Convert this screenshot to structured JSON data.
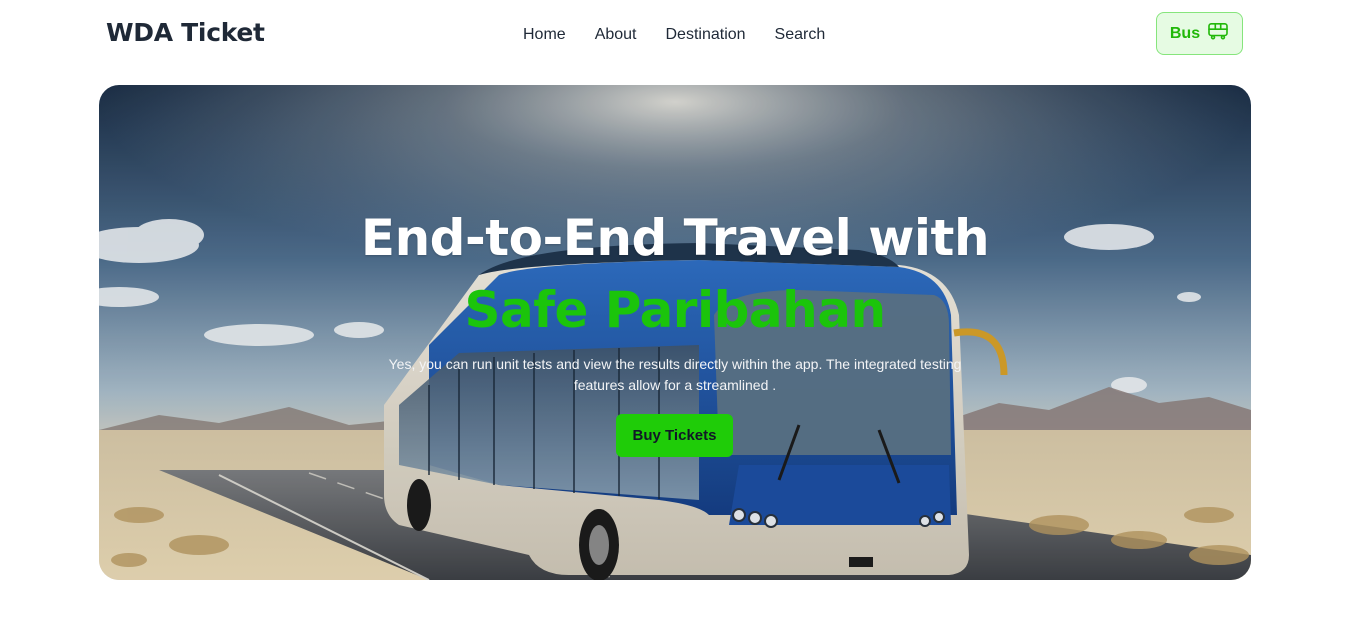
{
  "header": {
    "logo": "WDA Ticket",
    "nav": [
      {
        "label": "Home"
      },
      {
        "label": "About"
      },
      {
        "label": "Destination"
      },
      {
        "label": "Search"
      }
    ],
    "bus_button": {
      "label": "Bus",
      "icon": "bus-icon"
    }
  },
  "hero": {
    "title": "End-to-End Travel with",
    "highlight": "Safe Paribahan",
    "description": "Yes, you can run unit tests and view the results directly within the app. The integrated testing features allow for a streamlined .",
    "cta_label": "Buy Tickets",
    "background": "bus-on-desert-road-photo"
  },
  "colors": {
    "accent_green": "#1fcc08",
    "highlight_green": "#1bc40b",
    "bus_button_bg": "#e6fbe3",
    "bus_button_border": "#86e57c",
    "text_dark": "#1f2937"
  }
}
